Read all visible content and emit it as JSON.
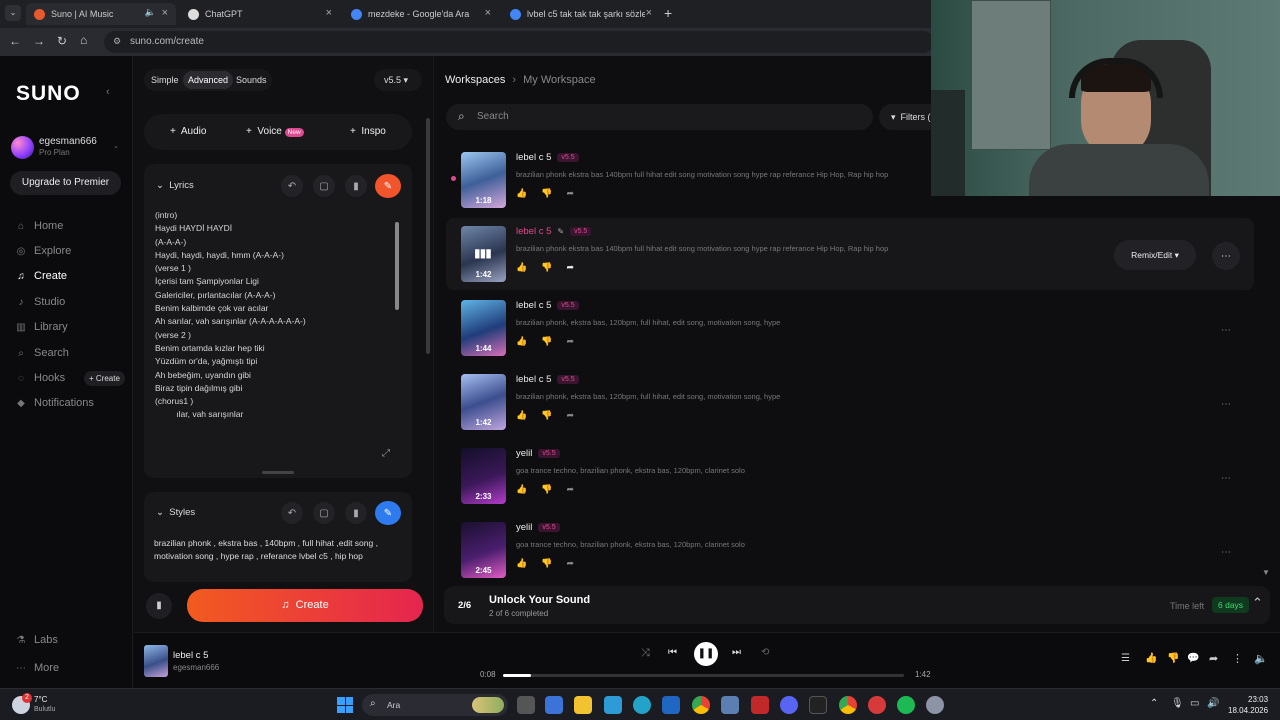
{
  "tabs": [
    {
      "title": "Suno | AI Music",
      "active": true
    },
    {
      "title": "ChatGPT"
    },
    {
      "title": "mezdeke - Google'da Ara"
    },
    {
      "title": "lvbel c5 tak tak tak şarkı sözleri"
    }
  ],
  "address": {
    "url": "suno.com/create"
  },
  "sidebar": {
    "logo": "SUNO",
    "user": {
      "name": "egesman666",
      "plan": "Pro Plan"
    },
    "upgrade_label": "Upgrade to Premier",
    "nav": [
      "Home",
      "Explore",
      "Create",
      "Studio",
      "Library",
      "Search",
      "Hooks",
      "Notifications"
    ],
    "hooks_create": "+ Create",
    "bottom": [
      "Labs",
      "More"
    ]
  },
  "create": {
    "modes": [
      "Simple",
      "Advanced",
      "Sounds"
    ],
    "version": "v5.5",
    "add_audio": "Audio",
    "add_voice": "Voice",
    "new_badge": "New",
    "inspo": "Inspo",
    "lyrics_title": "Lyrics",
    "lyrics_lines": [
      "(intro)",
      "Haydi HAYDİ HAYDİ",
      "(A-A-A-)",
      "Haydi, haydi, haydi, hmm (A-A-A-)",
      "",
      "(verse 1 )",
      "İçerisi tam Şampiyonlar Ligi",
      "Galericiler, pırlantacılar (A-A-A-)",
      "Benim kalbimde çok var acılar",
      "Ah sarılar, vah sarışınlar (A-A-A-A-A-A-)",
      "",
      "(verse 2 )",
      "Benim ortamda kızlar hep tiki",
      "Yüzdüm or'da, yağmıştı tipi",
      "Ah bebeğim, uyandın gibi",
      "Biraz tipin dağılmış gibi",
      "",
      "(chorus1 )",
      "         ılar, vah sarışınlar"
    ],
    "styles_title": "Styles",
    "styles_text": "brazilian phonk , ekstra bas , 140bpm , full hihat ,edit song , motivation song , hype rap , referance lvbel c5 , hip hop",
    "create_label": "Create"
  },
  "workspace": {
    "breadcrumb_root": "Workspaces",
    "breadcrumb_current": "My Workspace",
    "search_placeholder": "Search",
    "filters_label": "Filters (",
    "remix_label": "Remix/Edit",
    "songs": [
      {
        "title": "lebel c 5",
        "version": "v5.5",
        "desc": "brazilian phonk ekstra bas 140bpm full hihat edit song motivation song hype rap referance Hip Hop, Rap hip hop",
        "duration": "1:18"
      },
      {
        "title": "lebel c 5",
        "version": "v5.5",
        "desc": "brazilian phonk ekstra bas 140bpm full hihat edit song motivation song hype rap referance Hip Hop, Rap hip hop",
        "duration": "1:42"
      },
      {
        "title": "lebel c 5",
        "version": "v5.5",
        "desc": "brazilian phonk, ekstra bas, 120bpm, full hihat, edit song, motivation song, hype",
        "duration": "1:44"
      },
      {
        "title": "lebel c 5",
        "version": "v5.5",
        "desc": "brazilian phonk, ekstra bas, 120bpm, full hihat, edit song, motivation song, hype",
        "duration": "1:42"
      },
      {
        "title": "yelil",
        "version": "v5.5",
        "desc": "goa trance techno, brazilian phonk, ekstra bas, 120bpm, clarinet solo",
        "duration": "2:33"
      },
      {
        "title": "yelil",
        "version": "v5.5",
        "desc": "goa trance techno, brazilian phonk, ekstra bas, 120bpm, clarinet solo",
        "duration": "2:45"
      }
    ],
    "unlock": {
      "progress": "2/6",
      "title": "Unlock Your Sound",
      "sub": "2 of 6 completed",
      "time_left_label": "Time left",
      "days": "6 days"
    }
  },
  "player": {
    "title": "lebel c 5",
    "artist": "egesman666",
    "current": "0:08",
    "total": "1:42",
    "progress": 0.07
  },
  "taskbar": {
    "temp": "7°C",
    "weather": "Bulutlu",
    "search": "Ara",
    "time": "23:03",
    "date": "18.04.2026",
    "weather_badge": "2"
  },
  "colors": {
    "accent": "#e0488f",
    "create_grad_start": "#f25b1f",
    "create_grad_end": "#e5254f",
    "blue": "#2e7bf0"
  }
}
